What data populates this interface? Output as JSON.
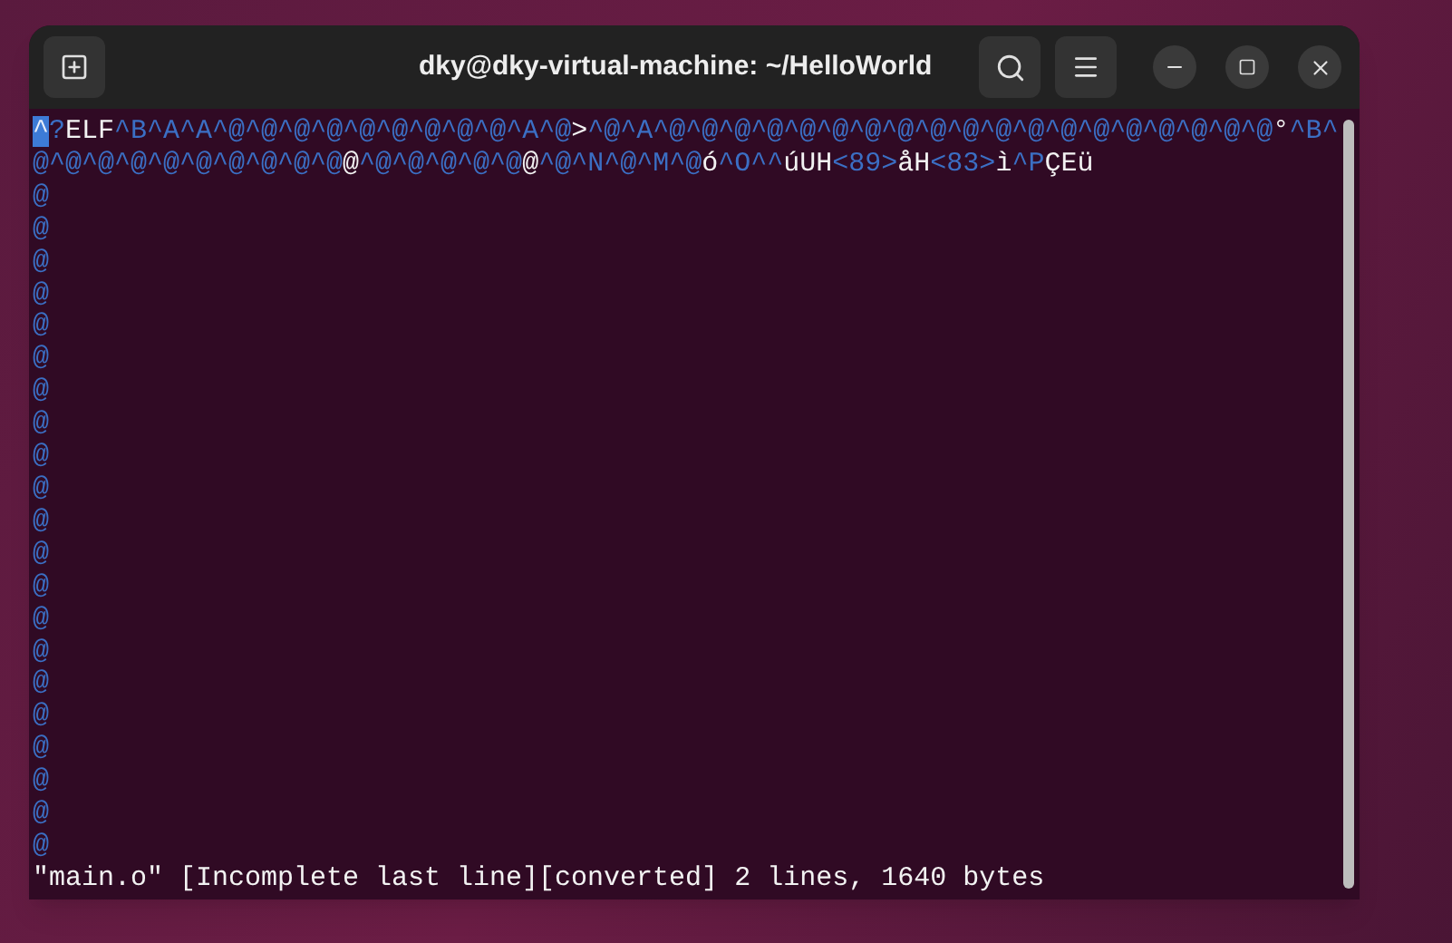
{
  "window": {
    "title": "dky@dky-virtual-machine: ~/HelloWorld"
  },
  "terminal": {
    "lines": [
      [
        {
          "kind": "cursor",
          "text": "^"
        },
        {
          "kind": "ctrl",
          "text": "?"
        },
        {
          "kind": "plain",
          "text": "ELF"
        },
        {
          "kind": "ctrl",
          "text": "^B^A^A^@^@^@^@^@^@^@^@^@^A^@"
        },
        {
          "kind": "plain",
          "text": ">"
        },
        {
          "kind": "ctrl",
          "text": "^@^A^@^@^@^@^@^@^@^@^@^@^@^@^@^@^@^@^@^@^@"
        },
        {
          "kind": "plain",
          "text": "°"
        },
        {
          "kind": "ctrl",
          "text": "^B^"
        }
      ],
      [
        {
          "kind": "ctrl",
          "text": "@^@^@^@^@^@^@^@^@^@"
        },
        {
          "kind": "plain",
          "text": "@"
        },
        {
          "kind": "ctrl",
          "text": "^@^@^@^@^@"
        },
        {
          "kind": "plain",
          "text": "@"
        },
        {
          "kind": "ctrl",
          "text": "^@^N^@^M^@"
        },
        {
          "kind": "plain",
          "text": "ó"
        },
        {
          "kind": "ctrl",
          "text": "^O^^"
        },
        {
          "kind": "plain",
          "text": "úUH"
        },
        {
          "kind": "ctrl",
          "text": "<89>"
        },
        {
          "kind": "plain",
          "text": "åH"
        },
        {
          "kind": "ctrl",
          "text": "<83>"
        },
        {
          "kind": "plain",
          "text": "ì"
        },
        {
          "kind": "ctrl",
          "text": "^P"
        },
        {
          "kind": "plain",
          "text": "ÇEü"
        }
      ]
    ],
    "filler_rows": [
      "@",
      "@",
      "@",
      "@",
      "@",
      "@",
      "@",
      "@",
      "@",
      "@",
      "@",
      "@",
      "@",
      "@",
      "@",
      "@",
      "@",
      "@",
      "@",
      "@",
      "@"
    ],
    "status_line": "\"main.o\" [Incomplete last line][converted] 2 lines, 1640 bytes"
  }
}
